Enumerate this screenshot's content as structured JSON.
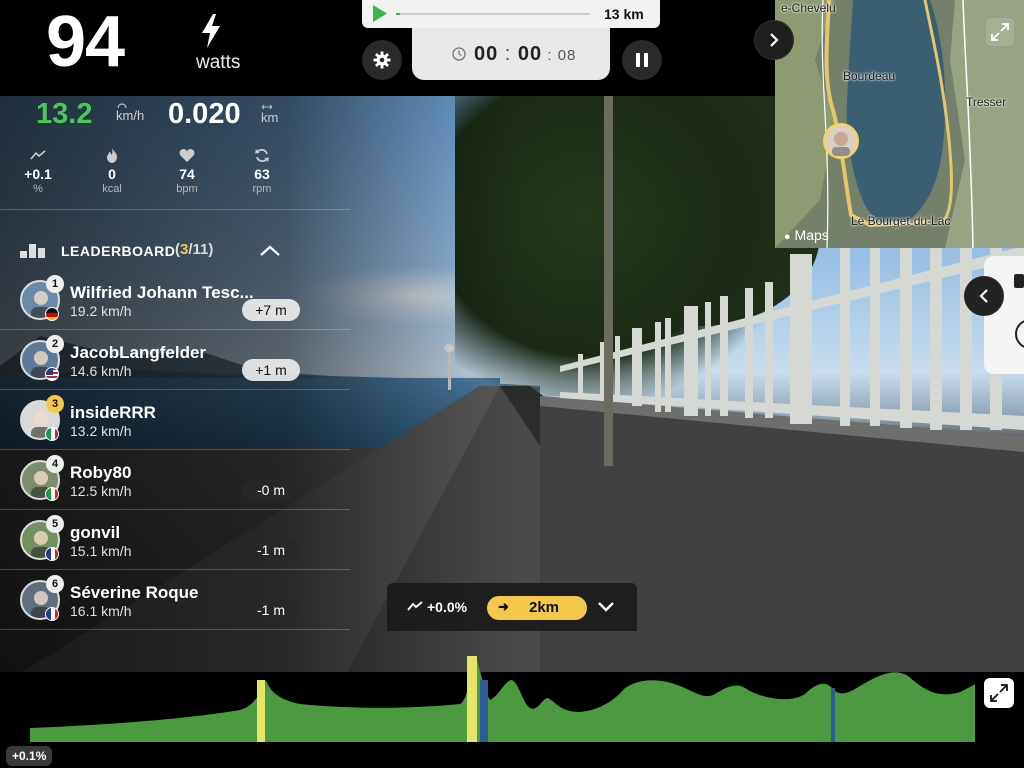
{
  "power": {
    "value": "94",
    "unit": "watts"
  },
  "route": {
    "total_distance": "13 km",
    "progress_fraction": 0.02
  },
  "timer": {
    "hours": "00",
    "minutes": "00",
    "seconds": "08"
  },
  "stats": {
    "speed": "13.2",
    "speed_unit": "km/h",
    "distance": "0.020",
    "distance_unit": "km",
    "slope": "+0.1",
    "slope_unit": "%",
    "kcal": "0",
    "kcal_unit": "kcal",
    "heart_rate": "74",
    "heart_rate_unit": "bpm",
    "cadence": "63",
    "cadence_unit": "rpm"
  },
  "leaderboard": {
    "title": "LEADERBOARD",
    "position": "3",
    "total": "11",
    "riders": [
      {
        "rank": "1",
        "name": "Wilfried Johann Tesc...",
        "speed": "19.2 km/h",
        "gap": "+7 m",
        "gap_style": "light",
        "flag": "de",
        "avatar_color": "#6a8aa8"
      },
      {
        "rank": "2",
        "name": "JacobLangfelder",
        "speed": "14.6 km/h",
        "gap": "+1 m",
        "gap_style": "light",
        "flag": "us",
        "avatar_color": "#5d7b96"
      },
      {
        "rank": "3",
        "name": "insideRRR",
        "speed": "13.2 km/h",
        "gap": "",
        "gap_style": "none",
        "flag": "it",
        "avatar_color": "#d9d9d9"
      },
      {
        "rank": "4",
        "name": "Roby80",
        "speed": "12.5 km/h",
        "gap": "-0 m",
        "gap_style": "dark",
        "flag": "it",
        "avatar_color": "#7d8d6c"
      },
      {
        "rank": "5",
        "name": "gonvil",
        "speed": "15.1 km/h",
        "gap": "-1 m",
        "gap_style": "dark",
        "flag": "fr",
        "avatar_color": "#73905e"
      },
      {
        "rank": "6",
        "name": "Séverine Roque",
        "speed": "16.1 km/h",
        "gap": "-1 m",
        "gap_style": "dark",
        "flag": "fr",
        "avatar_color": "#5f6f80"
      }
    ]
  },
  "map": {
    "labels": [
      "e-Chevelu",
      "Bourdeau",
      "Tresser",
      "Le Bourget-du-Lac",
      "Maps"
    ],
    "attribution": "Maps"
  },
  "route_bar": {
    "slope": "+0.0%",
    "next_distance": "2km"
  },
  "profile": {
    "grade": "+0.1%"
  },
  "colors": {
    "accent_green": "#4cc85a",
    "accent_yellow": "#f6c84a",
    "profile_green": "#4c9a3f"
  },
  "icons": {
    "power": "bolt-icon",
    "play": "play-icon",
    "clock": "clock-icon",
    "settings": "gear-icon",
    "pause": "pause-icon",
    "map_next": "chevron-right-icon",
    "map_expand": "expand-icon",
    "slope": "slope-icon",
    "kcal": "flame-icon",
    "heart": "heart-icon",
    "cadence": "refresh-icon",
    "leaderboard": "bars-icon",
    "collapse": "chevron-up-icon",
    "drawer": "chevron-left-icon",
    "route_expand": "chevron-down-icon",
    "profile_expand": "expand-icon"
  }
}
